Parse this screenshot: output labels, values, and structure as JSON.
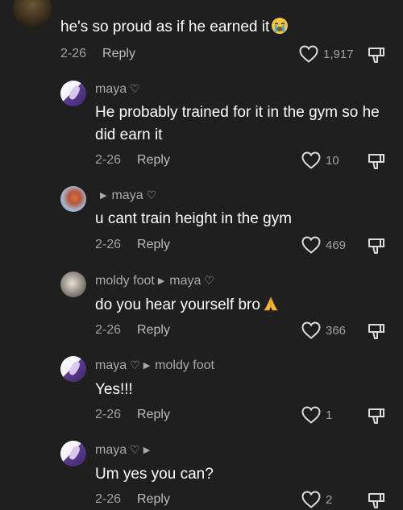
{
  "comments": [
    {
      "text": "he's so proud as if he earned it",
      "date": "2-26",
      "reply": "Reply",
      "likes": "1,917"
    },
    {
      "name": "maya",
      "text": "He probably trained for it in the gym so he did earn it",
      "date": "2-26",
      "reply": "Reply",
      "likes": "10"
    },
    {
      "name": "",
      "reply_to": "maya",
      "text": "u cant train height in the gym",
      "date": "2-26",
      "reply": "Reply",
      "likes": "469"
    },
    {
      "name": "moldy foot",
      "reply_to": "maya",
      "text": "do you hear yourself bro",
      "date": "2-26",
      "reply": "Reply",
      "likes": "366"
    },
    {
      "name": "maya",
      "reply_to": "moldy foot",
      "text": "Yes!!!",
      "date": "2-26",
      "reply": "Reply",
      "likes": "1"
    },
    {
      "name": "maya",
      "text": "Um yes you can?",
      "date": "2-26",
      "reply": "Reply",
      "likes": "2"
    }
  ],
  "icons": {
    "heart": "heart-icon",
    "dislike": "thumbs-down-icon",
    "creator_badge": "heart-outline-icon",
    "reply_arrow": "triangle-right-icon",
    "emoji_crying": "loudly-crying-face-emoji",
    "emoji_pray": "folded-hands-emoji"
  },
  "colors": {
    "background": "#1f1f1f",
    "text": "#ffffff",
    "muted": "#a0a0a0"
  }
}
